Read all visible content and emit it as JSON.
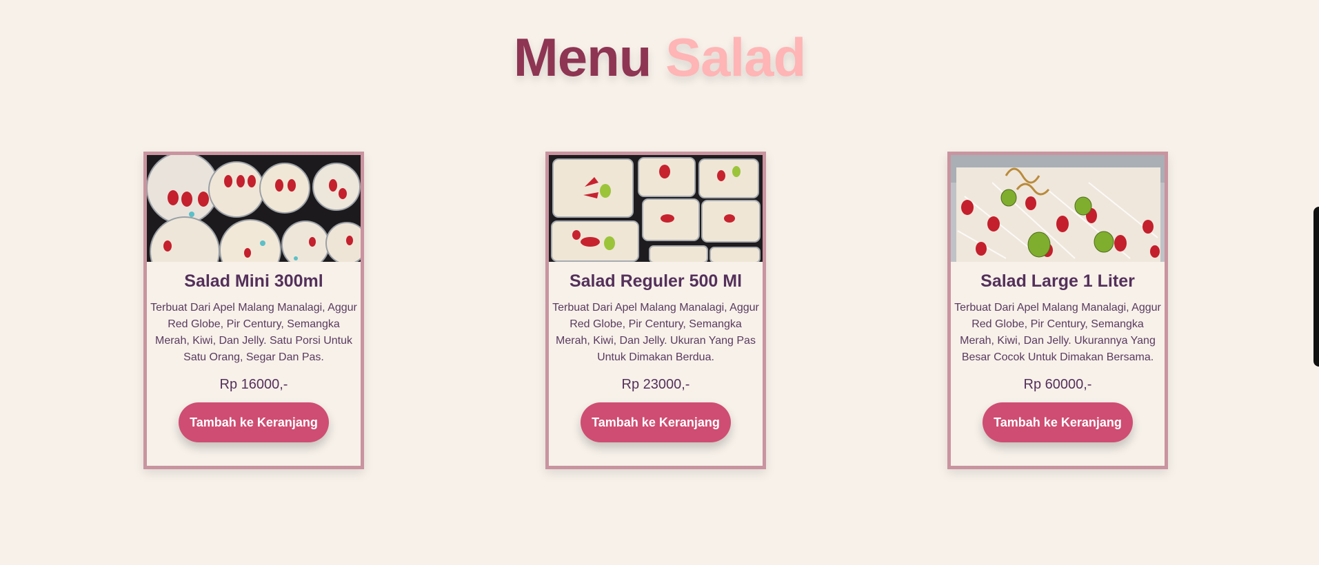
{
  "heading": {
    "word1": "Menu",
    "word2": "Salad"
  },
  "menu_items": [
    {
      "title": "Salad Mini 300ml",
      "description": "Terbuat Dari Apel Malang Manalagi, Aggur Red Globe, Pir Century, Semangka Merah, Kiwi, Dan Jelly. Satu Porsi Untuk Satu Orang, Segar Dan Pas.",
      "price": "Rp 16000,-",
      "button_label": "Tambah ke Keranjang"
    },
    {
      "title": "Salad Reguler 500 Ml",
      "description": "Terbuat Dari Apel Malang Manalagi, Aggur Red Globe, Pir Century, Semangka Merah, Kiwi, Dan Jelly. Ukuran Yang Pas Untuk Dimakan Berdua.",
      "price": "Rp 23000,-",
      "button_label": "Tambah ke Keranjang"
    },
    {
      "title": "Salad Large 1 Liter",
      "description": "Terbuat Dari Apel Malang Manalagi, Aggur Red Globe, Pir Century, Semangka Merah, Kiwi, Dan Jelly. Ukurannya Yang Besar Cocok Untuk Dimakan Bersama.",
      "price": "Rp 60000,-",
      "button_label": "Tambah ke Keranjang"
    }
  ],
  "colors": {
    "background": "#f7f1ea",
    "heading_primary": "#8e3553",
    "heading_accent": "#ffb5b5",
    "card_border": "#c9949f",
    "button": "#cf4d72",
    "text": "#54305a"
  }
}
